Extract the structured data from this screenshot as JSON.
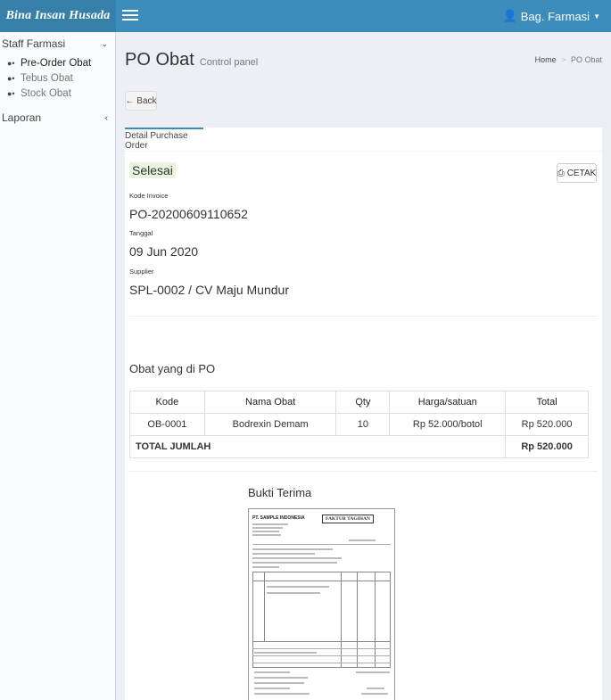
{
  "app": {
    "logo": "Bina Insan Husada",
    "user": "Bag. Farmasi"
  },
  "sidebar": {
    "group_label": "Staff Farmasi",
    "items": [
      {
        "label": "Pre-Order Obat"
      },
      {
        "label": "Tebus Obat"
      },
      {
        "label": "Stock Obat"
      }
    ],
    "laporan_label": "Laporan"
  },
  "header": {
    "title": "PO Obat",
    "subtitle": "Control panel",
    "breadcrumb": {
      "home": "Home",
      "current": "PO Obat"
    }
  },
  "toolbar": {
    "back_label": "Back",
    "cetak_label": "CETAK"
  },
  "tab": {
    "label": "Detail Purchase Order"
  },
  "detail": {
    "status": "Selesai",
    "invoice_label": "Kode Invoice",
    "invoice_value": "PO-20200609110652",
    "date_label": "Tanggal",
    "date_value": "09 Jun 2020",
    "supplier_label": "Supplier",
    "supplier_value": "SPL-0002 / CV Maju Mundur"
  },
  "items_section": {
    "title": "Obat yang di PO",
    "columns": [
      "Kode",
      "Nama Obat",
      "Qty",
      "Harga/satuan",
      "Total"
    ],
    "rows": [
      {
        "kode": "OB-0001",
        "nama": "Bodrexin Demam",
        "qty": "10",
        "harga": "Rp 52.000/botol",
        "total": "Rp 520.000"
      }
    ],
    "total_label": "TOTAL JUMLAH",
    "total_value": "Rp 520.000"
  },
  "bukti": {
    "title": "Bukti Terima",
    "doc_company": "PT. SAMPLE INDONESIA",
    "doc_title": "FAKTUR TAGIHAN"
  }
}
